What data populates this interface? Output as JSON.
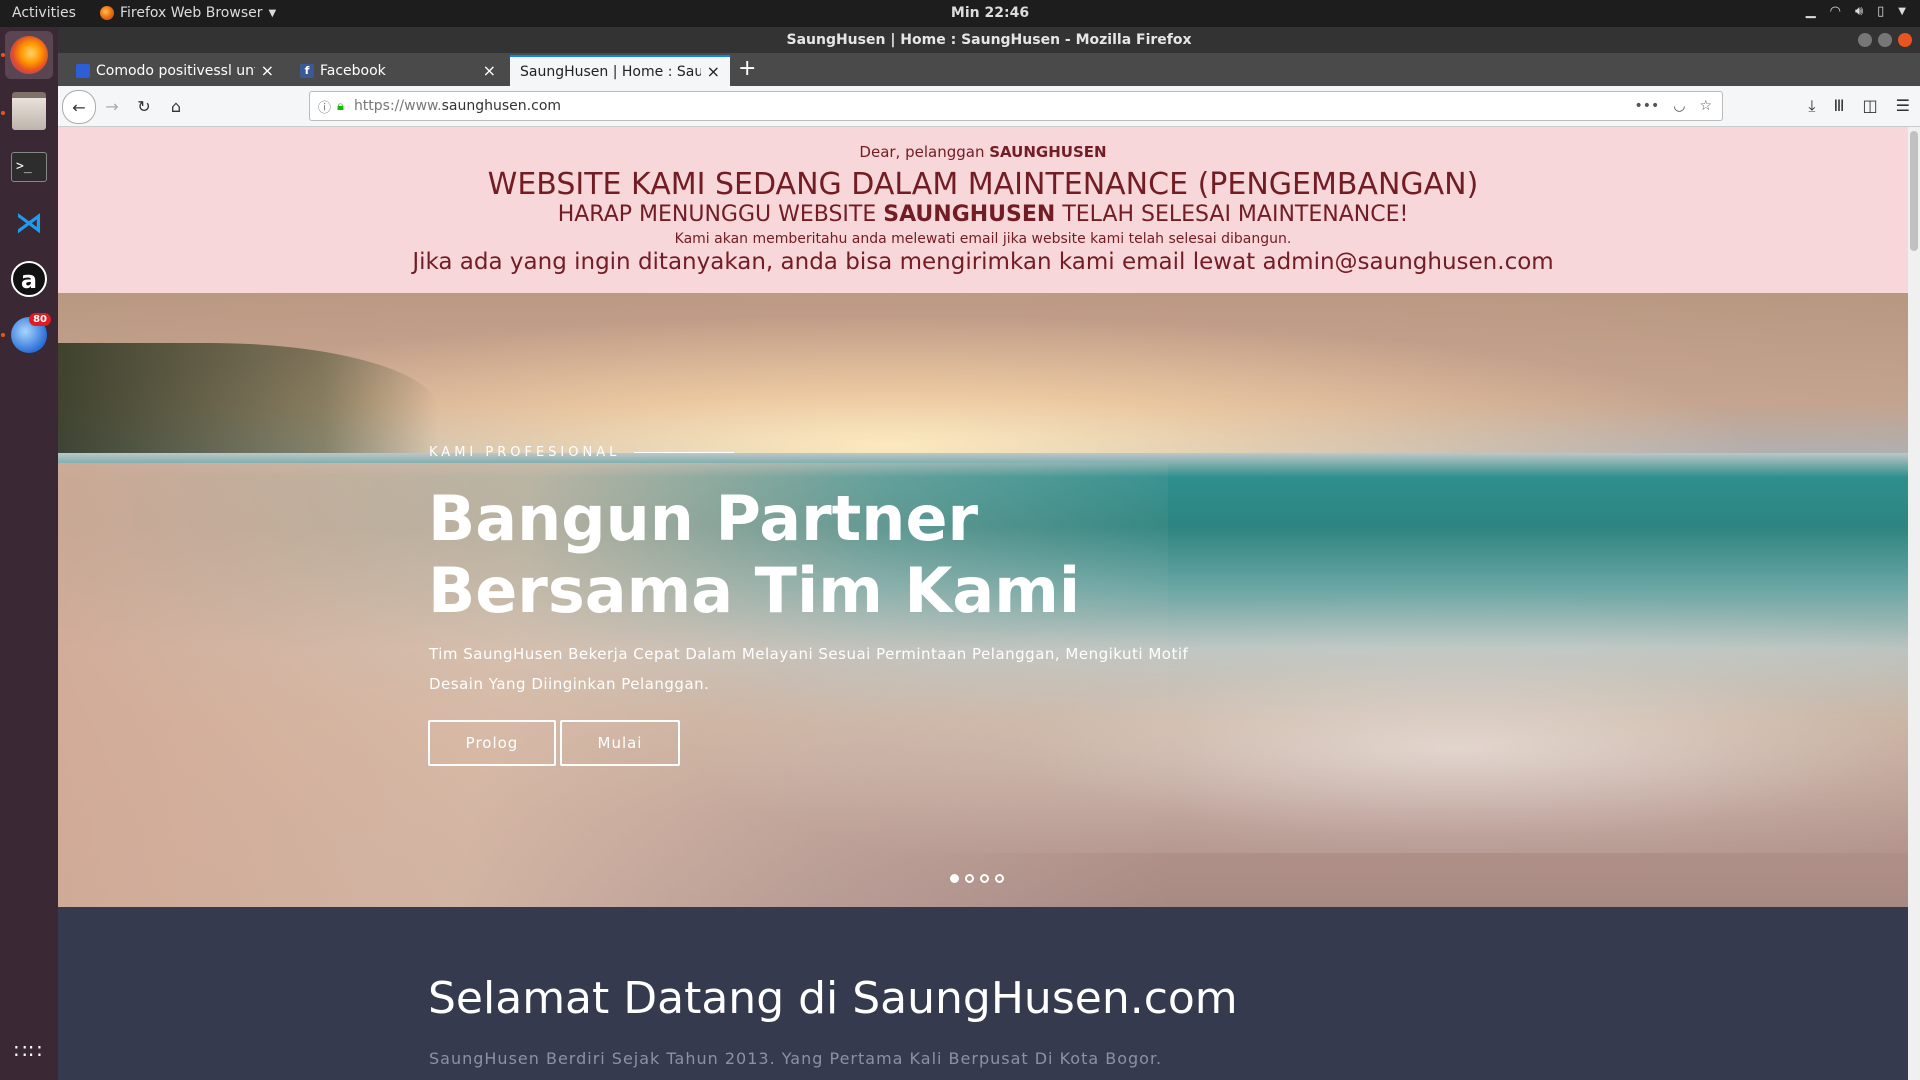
{
  "topbar": {
    "activities": "Activities",
    "app_name": "Firefox Web Browser",
    "clock": "Min 22:46"
  },
  "dock": {
    "badge_count": "80"
  },
  "window": {
    "title": "SaungHusen | Home : SaungHusen - Mozilla Firefox"
  },
  "tabs": [
    {
      "label": "Comodo positivessl untu"
    },
    {
      "label": "Facebook"
    },
    {
      "label": "SaungHusen | Home : SaungH"
    }
  ],
  "urlbar": {
    "protocol": "https://www.",
    "domain": "saunghusen.com"
  },
  "notice": {
    "greeting_prefix": "Dear, pelanggan ",
    "greeting_brand": "SAUNGHUSEN",
    "headline": "WEBSITE KAMI SEDANG DALAM MAINTENANCE (PENGEMBANGAN)",
    "wait_prefix": "HARAP MENUNGGU WEBSITE ",
    "wait_brand": "SAUNGHUSEN",
    "wait_suffix": " TELAH SELESAI MAINTENANCE!",
    "info": "Kami akan memberitahu anda melewati email jika website kami telah selesai dibangun.",
    "contact": "Jika ada yang ingin ditanyakan, anda bisa mengirimkan kami email lewat admin@saunghusen.com"
  },
  "hero": {
    "eyebrow": "KAMI PROFESIONAL",
    "title_line1": "Bangun Partner",
    "title_line2": "Bersama Tim Kami",
    "subtitle": "Tim SaungHusen Bekerja Cepat Dalam Melayani Sesuai Permintaan Pelanggan, Mengikuti Motif Desain Yang Diinginkan Pelanggan.",
    "btn_prolog": "Prolog",
    "btn_mulai": "Mulai",
    "slides_total": 4,
    "slide_active": 1
  },
  "welcome": {
    "title": "Selamat Datang di SaungHusen.com",
    "text": "SaungHusen Berdiri Sejak Tahun 2013. Yang Pertama Kali Berpusat Di Kota Bogor."
  },
  "colors": {
    "notice_bg": "#f8d7da",
    "notice_text": "#721c24",
    "welcome_bg": "#363a4e",
    "tab_accent": "#0a84ff",
    "dock_bg": "#3a2834"
  }
}
